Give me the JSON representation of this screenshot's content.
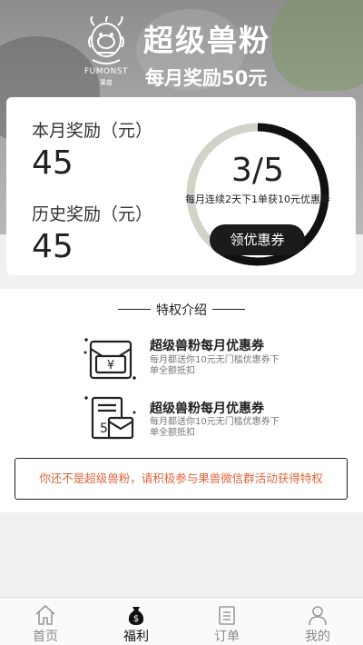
{
  "hero": {
    "logo_text": "FUMONST",
    "logo_sub": "果兽",
    "title": "超级兽粉",
    "subtitle": "每月奖励50元"
  },
  "stats": {
    "month_label": "本月奖励（元）",
    "month_value": "45",
    "history_label": "历史奖励（元）",
    "history_value": "45",
    "progress_text": "3/5",
    "progress_current": 3,
    "progress_total": 5,
    "progress_desc": "每月连续2天下1单获10元优惠券",
    "claim_button": "领优惠券"
  },
  "privileges": {
    "title": "特权介绍",
    "items": [
      {
        "icon": "coupon-envelope-icon",
        "title": "超级兽粉每月优惠券",
        "desc": "每月都送你10元无门槛优惠券下单全额抵扣"
      },
      {
        "icon": "coupon-document-icon",
        "title": "超级兽粉每月优惠券",
        "desc": "每月都送你10元无门槛优惠券下单全额抵扣"
      }
    ]
  },
  "notice": "你还不是超级兽粉，请积极参与果兽微信群活动获得特权",
  "tabs": [
    {
      "label": "首页",
      "icon": "home-icon",
      "active": false
    },
    {
      "label": "福利",
      "icon": "money-bag-icon",
      "active": true
    },
    {
      "label": "订单",
      "icon": "order-list-icon",
      "active": false
    },
    {
      "label": "我的",
      "icon": "user-icon",
      "active": false
    }
  ],
  "colors": {
    "accent_dark": "#1b1b1b",
    "notice_text": "#e0643a",
    "ring_track": "#cfd3c8"
  }
}
